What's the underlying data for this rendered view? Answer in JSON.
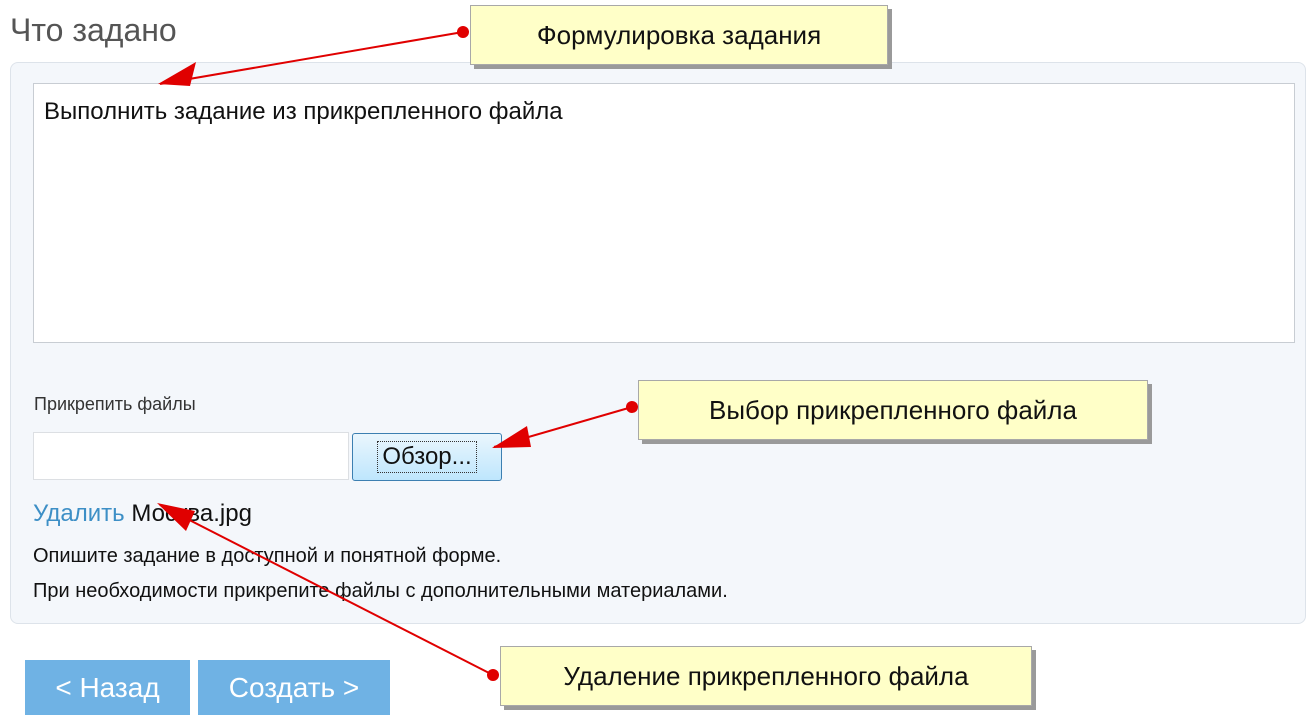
{
  "section": {
    "title": "Что задано"
  },
  "task": {
    "text": "Выполнить задание из прикрепленного файла"
  },
  "attachments": {
    "label": "Прикрепить файлы",
    "file_input_value": "",
    "browse_label": "Обзор...",
    "delete_label": "Удалить",
    "file_name": "Москва.jpg"
  },
  "hints": [
    "Опишите задание в доступной и понятной форме.",
    "При необходимости прикрепите файлы с дополнительными материалами."
  ],
  "nav": {
    "back_label": "< Назад",
    "create_label": "Создать >"
  },
  "annotations": [
    {
      "label": "Формулировка задания"
    },
    {
      "label": "Выбор прикрепленного файла"
    },
    {
      "label": "Удаление прикрепленного файла"
    }
  ],
  "colors": {
    "link": "#3d8fc6",
    "nav_button": "#6fb2e4",
    "callout_background": "#ffffc8",
    "arrow": "#e00000"
  }
}
